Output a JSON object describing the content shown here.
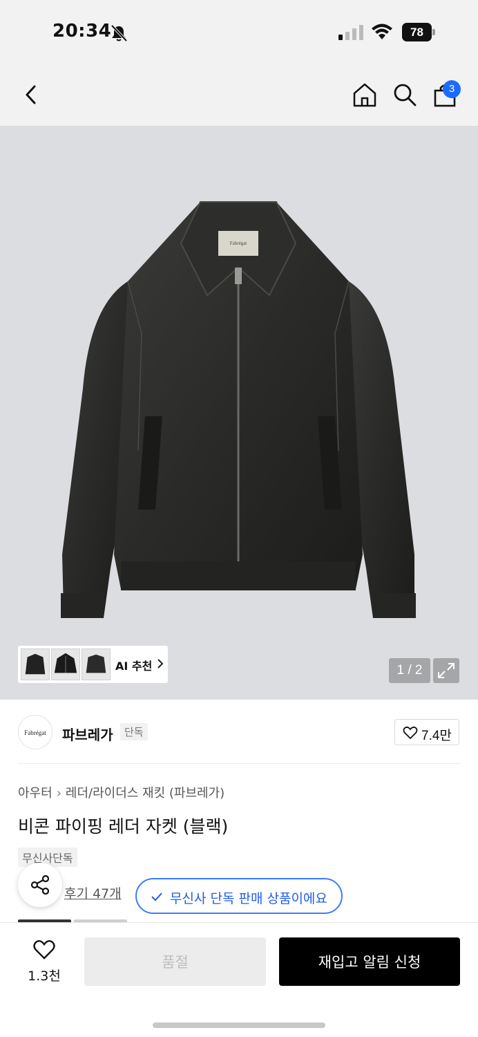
{
  "status_bar": {
    "time": "20:34",
    "battery": "78"
  },
  "nav": {
    "cart_count": "3"
  },
  "gallery": {
    "ai_label": "AI 추천",
    "page_counter": "1 / 2",
    "label_brand_text": "Fabrégat",
    "background_color": "#dcdde1"
  },
  "brand": {
    "logo_text": "Fabrégat",
    "name": "파브레가",
    "tag": "단독",
    "likes": "7.4만"
  },
  "product": {
    "breadcrumb": [
      "아우터",
      "레더/라이더스 재킷 (파브레가)"
    ],
    "title": "비콘 파이핑 레더 자켓 (블랙)",
    "exclusive_tag": "무신사단독",
    "review": "후기 47개",
    "exclusive_notice": "무신사 단독 판매 상품이에요"
  },
  "bottom_bar": {
    "wish_count": "1.3천",
    "soldout_label": "품절",
    "restock_label": "재입고 알림 신청"
  },
  "colors": {
    "accent_blue": "#1f5de8",
    "badge_blue": "#1c6bff",
    "cta_black": "#000000"
  }
}
